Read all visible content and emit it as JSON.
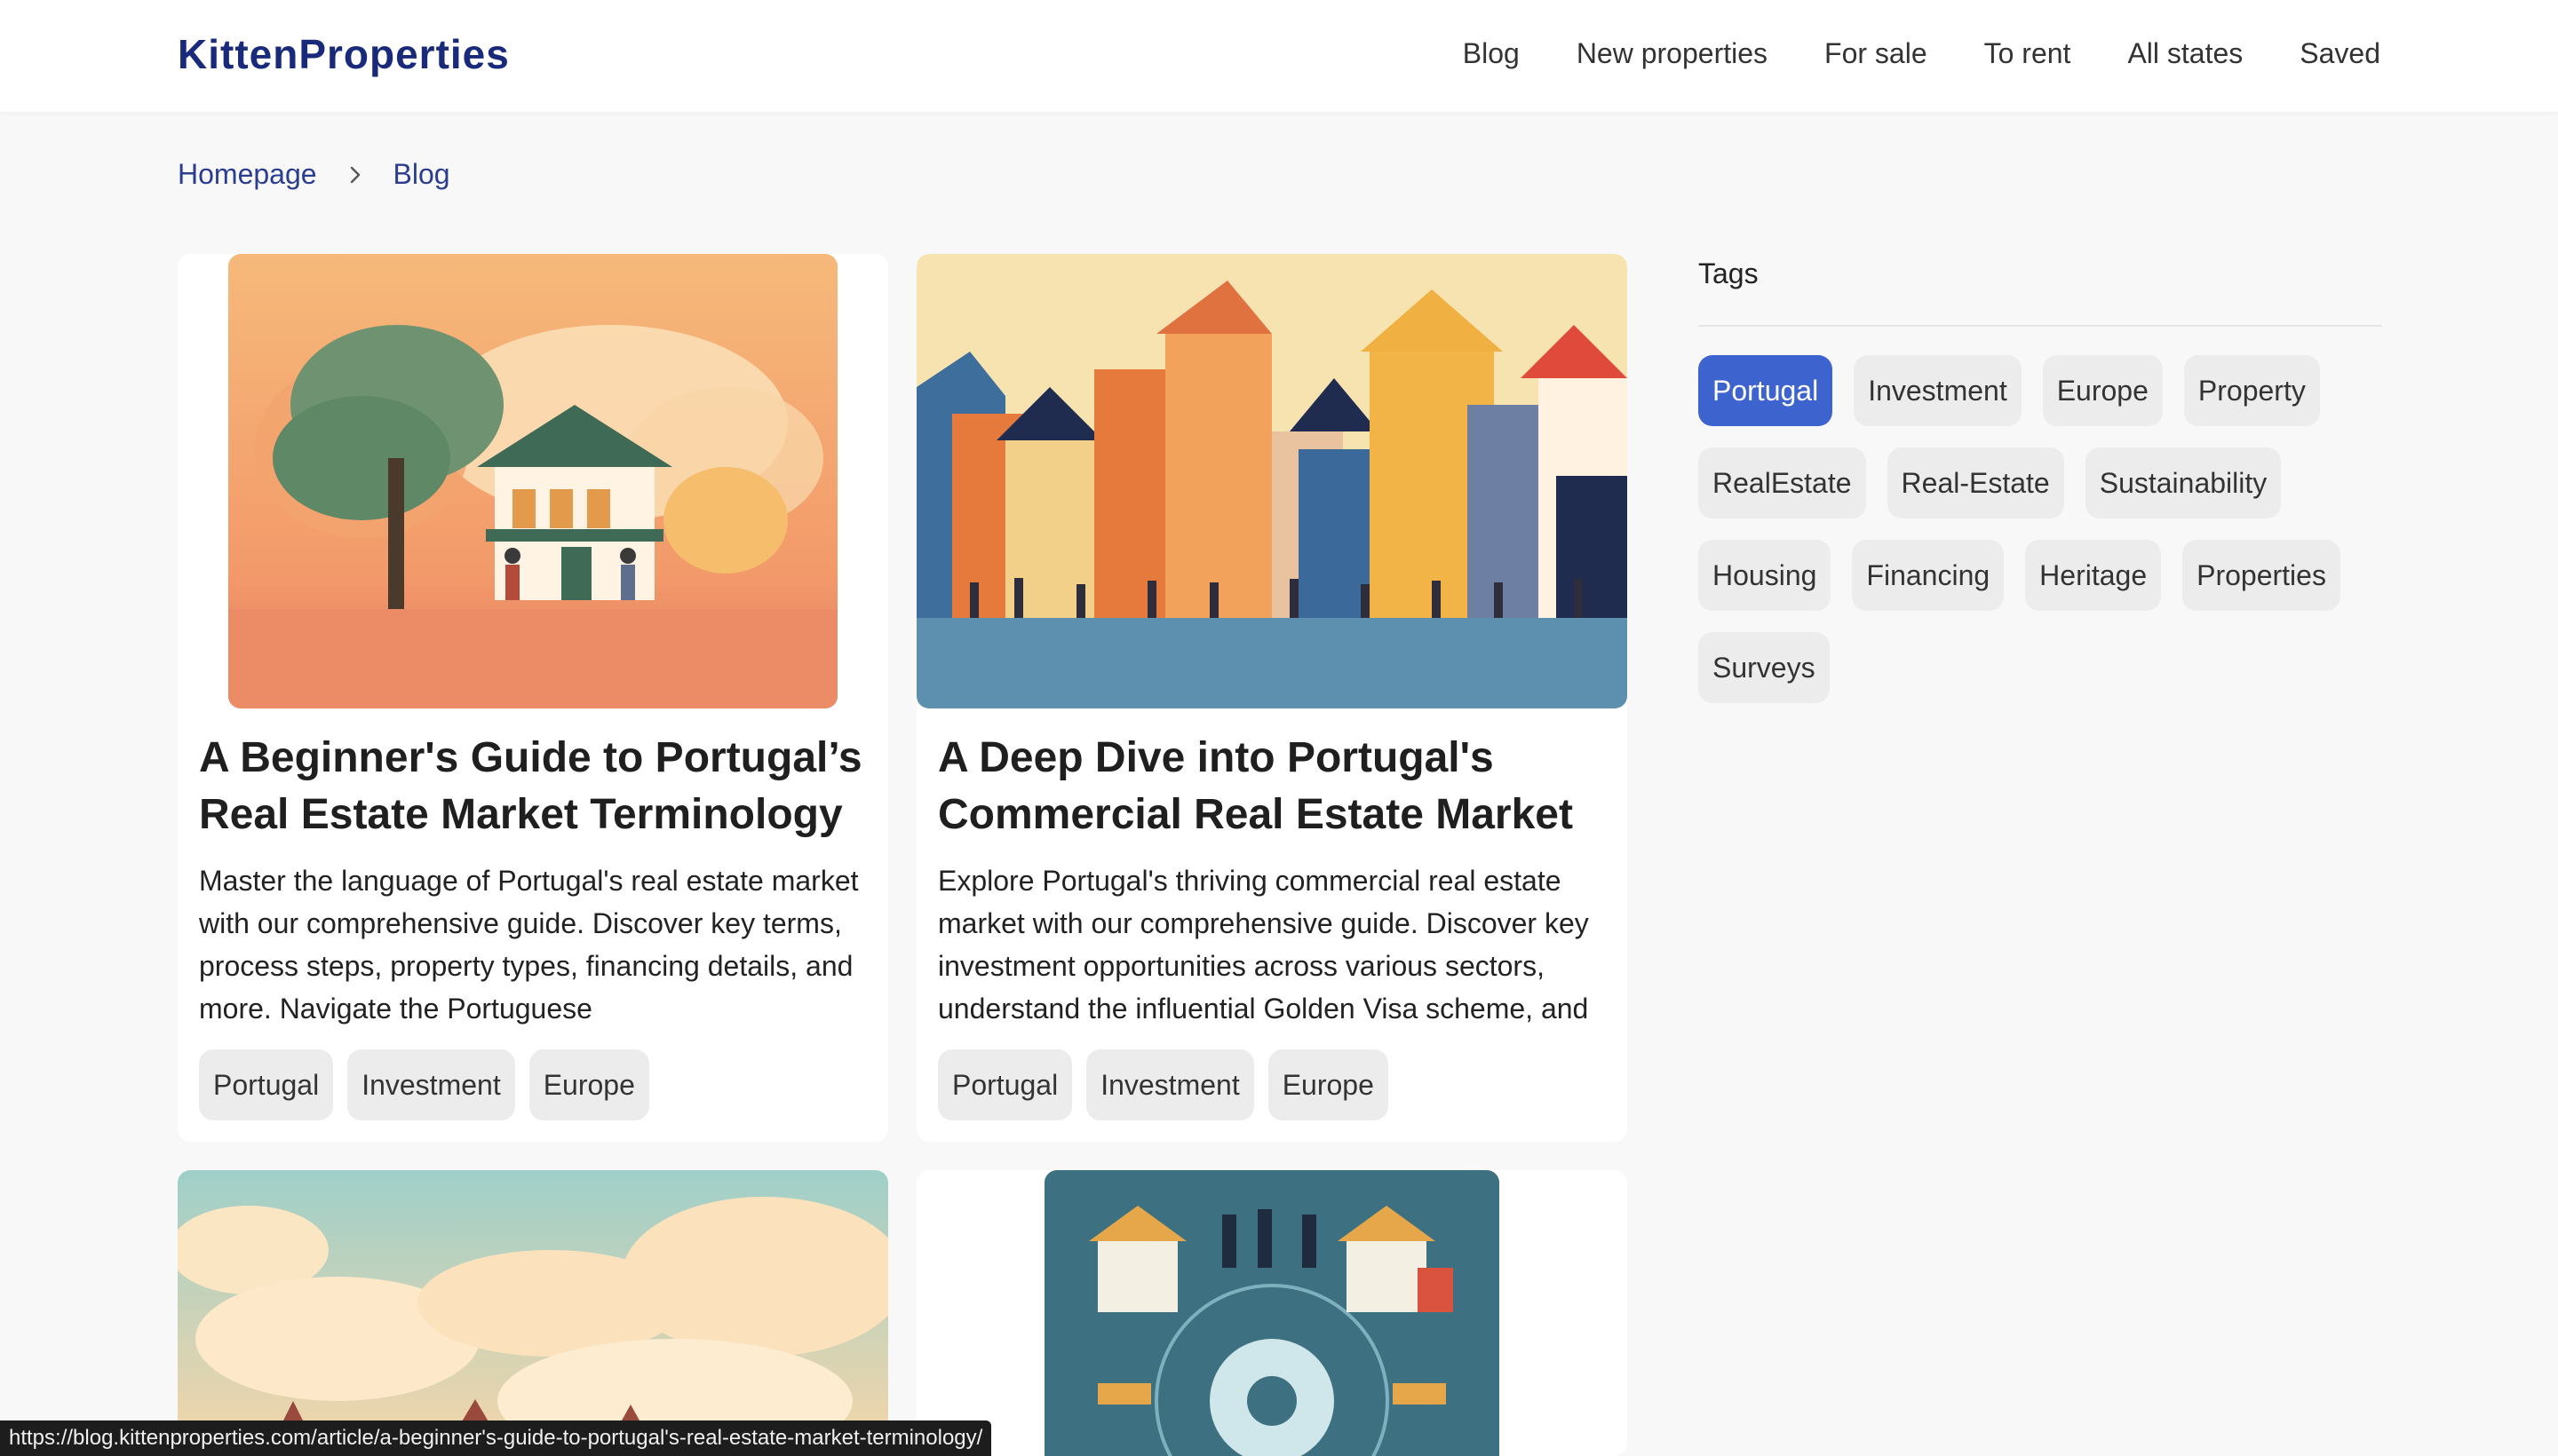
{
  "site": {
    "logo": "KittenProperties"
  },
  "nav": [
    "Blog",
    "New properties",
    "For sale",
    "To rent",
    "All states",
    "Saved"
  ],
  "breadcrumb": {
    "home": "Homepage",
    "current": "Blog"
  },
  "articles": [
    {
      "title": "A Beginner's Guide to Portugal’s Real Estate Market Terminology",
      "description": "Master the language of Portugal's real estate market with our comprehensive guide. Discover key terms, process steps, property types, financing details, and more. Navigate the Portuguese",
      "tags": [
        "Portugal",
        "Investment",
        "Europe"
      ]
    },
    {
      "title": "A Deep Dive into Portugal's Commercial Real Estate Market",
      "description": "Explore Portugal's thriving commercial real estate market with our comprehensive guide. Discover key investment opportunities across various sectors, understand the influential Golden Visa scheme, and",
      "tags": [
        "Portugal",
        "Investment",
        "Europe"
      ]
    }
  ],
  "sidebar": {
    "title": "Tags",
    "tags": [
      "Portugal",
      "Investment",
      "Europe",
      "Property",
      "RealEstate",
      "Real-Estate",
      "Sustainability",
      "Housing",
      "Financing",
      "Heritage",
      "Properties",
      "Surveys"
    ],
    "active": "Portugal"
  },
  "status_url": "https://blog.kittenproperties.com/article/a-beginner's-guide-to-portugal's-real-estate-market-terminology/",
  "colors": {
    "brand": "#1a2a7a",
    "active_tag": "#3d63cf",
    "chip": "#ececec"
  }
}
